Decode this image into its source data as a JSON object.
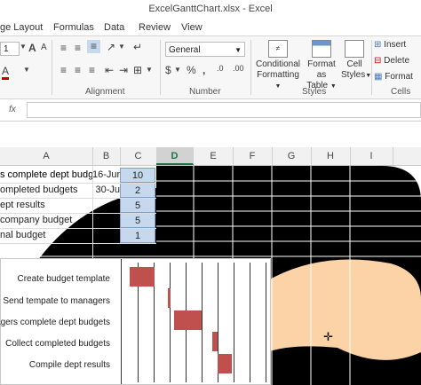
{
  "window": {
    "title": "ExcelGanttChart.xlsx - Excel"
  },
  "tabs": [
    "ge Layout",
    "Formulas",
    "Data",
    "Review",
    "View"
  ],
  "ribbon": {
    "font_size": "1",
    "number_format": "General",
    "alignment_label": "Alignment",
    "number_label": "Number",
    "styles_label": "Styles",
    "cells_label": "Cells",
    "conditional_formatting": [
      "Conditional",
      "Formatting"
    ],
    "format_as_table": [
      "Format as",
      "Table"
    ],
    "cell_styles": [
      "Cell",
      "Styles"
    ],
    "insert": "Insert",
    "delete": "Delete",
    "format": "Format"
  },
  "formula_bar": {
    "fx": "fx",
    "value": ""
  },
  "columns": [
    "A",
    "B",
    "C",
    "D",
    "E",
    "F",
    "G",
    "H",
    "I"
  ],
  "rows": [
    {
      "a": "s complete dept budge",
      "b": "16-Jun",
      "c": "10"
    },
    {
      "a": "ompleted budgets",
      "b": "30-Ju",
      "c": "2"
    },
    {
      "a": "ept results",
      "b": "",
      "c": "5"
    },
    {
      "a": "company budget",
      "b": "",
      "c": "5"
    },
    {
      "a": "nal budget",
      "b": "",
      "c": "1"
    }
  ],
  "chart_data": {
    "type": "bar",
    "categories": [
      "Create budget template",
      "Send tempate to managers",
      "nagers complete dept budgets",
      "Collect completed budgets",
      "Compile dept results"
    ],
    "start": [
      0,
      14,
      16,
      30,
      32
    ],
    "duration": [
      9,
      1,
      10,
      2,
      5
    ]
  },
  "colors": {
    "bar": "#c0504d",
    "highlight": "#c6d8ee",
    "peach": "#fbd3a6",
    "selected_col": "#1e7145"
  }
}
